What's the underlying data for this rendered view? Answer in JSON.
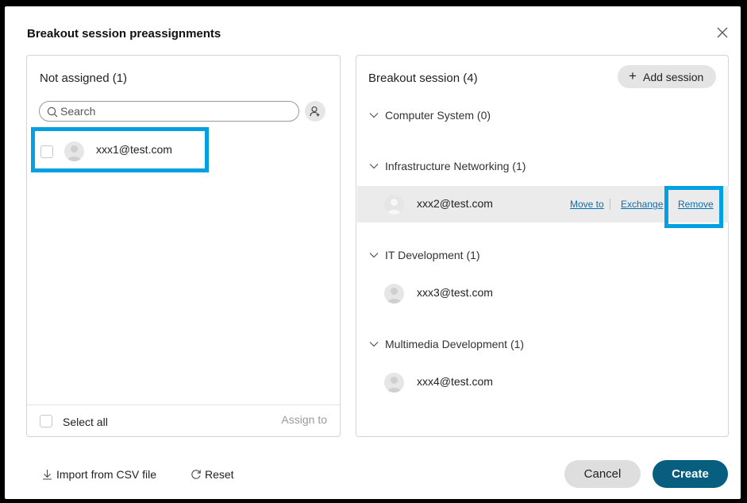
{
  "dialog": {
    "title": "Breakout session preassignments"
  },
  "left_panel": {
    "title": "Not assigned (1)",
    "search_placeholder": "Search",
    "users": [
      {
        "email": "xxx1@test.com"
      }
    ],
    "select_all_label": "Select all",
    "assign_to_label": "Assign to"
  },
  "right_panel": {
    "title": "Breakout session (4)",
    "add_session_label": "Add session",
    "sessions": [
      {
        "name": "Computer System (0)",
        "members": []
      },
      {
        "name": "Infrastructure Networking (1)",
        "members": [
          {
            "email": "xxx2@test.com"
          }
        ]
      },
      {
        "name": "IT Development (1)",
        "members": [
          {
            "email": "xxx3@test.com"
          }
        ]
      },
      {
        "name": "Multimedia Development (1)",
        "members": [
          {
            "email": "xxx4@test.com"
          }
        ]
      }
    ],
    "row_actions": {
      "move_to": "Move to",
      "exchange": "Exchange",
      "remove": "Remove"
    }
  },
  "footer": {
    "import_label": "Import from CSV file",
    "reset_label": "Reset",
    "cancel_label": "Cancel",
    "create_label": "Create"
  },
  "colors": {
    "accent_highlight": "#00a0e3",
    "primary_button": "#075e7e",
    "link": "#0b6eaf"
  },
  "icons": [
    "close-icon",
    "search-icon",
    "add-user-icon",
    "avatar-icon",
    "chevron-down-icon",
    "plus-icon",
    "download-icon",
    "reset-icon"
  ]
}
